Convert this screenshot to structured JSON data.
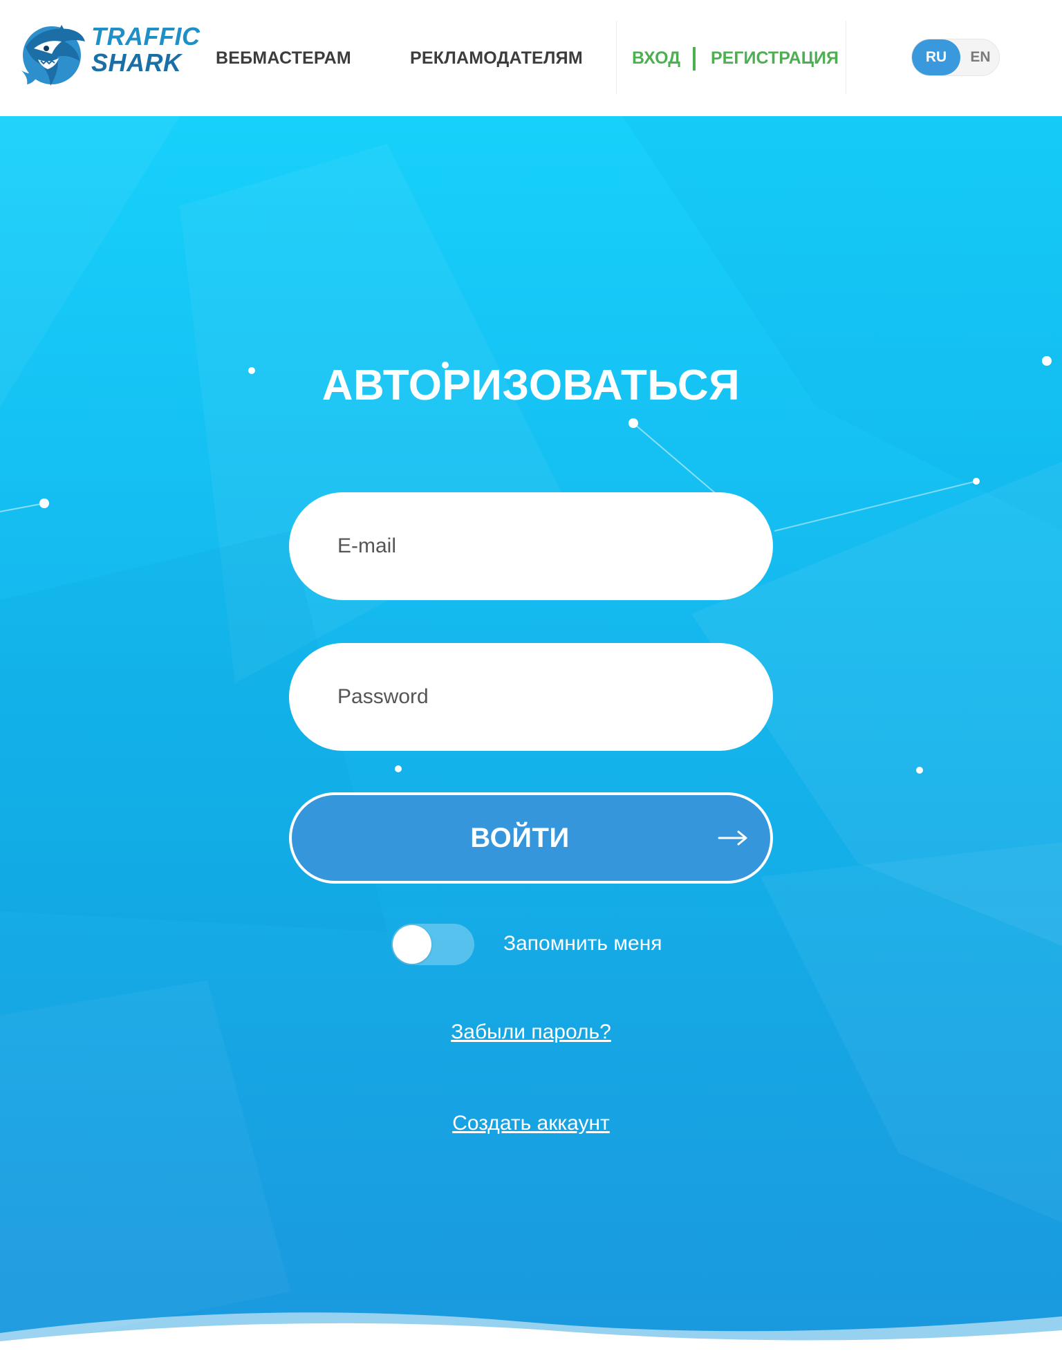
{
  "brand": {
    "logo_line1": "TRAFFIC",
    "logo_line2": "SHARK",
    "logo_icon": "shark-icon",
    "colors": {
      "primary": "#1f8fc7",
      "accent_green": "#4caf50",
      "button_blue": "#3596db"
    }
  },
  "nav": {
    "webmasters": "ВЕБМАСТЕРАМ",
    "advertisers": "РЕКЛАМОДАТЕЛЯМ"
  },
  "auth": {
    "login": "ВХОД",
    "register": "РЕГИСТРАЦИЯ"
  },
  "lang": {
    "options": [
      "RU",
      "EN"
    ],
    "selected": "RU"
  },
  "form": {
    "title": "АВТОРИЗОВАТЬСЯ",
    "email_placeholder": "E-mail",
    "password_placeholder": "Password",
    "submit_label": "ВОЙТИ",
    "submit_icon": "arrow-right-icon",
    "remember_label": "Запомнить меня",
    "remember_checked": false,
    "forgot_link": "Забыли пароль?",
    "create_link": "Создать аккаунт"
  }
}
